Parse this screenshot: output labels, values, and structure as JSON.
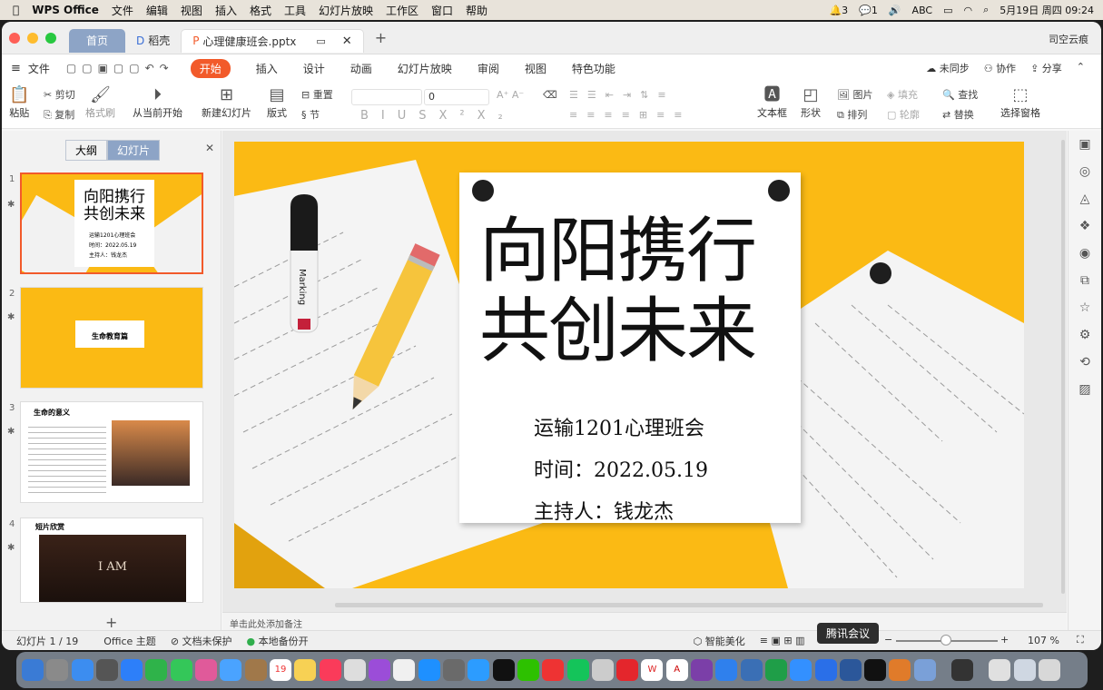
{
  "menubar": {
    "app": "WPS Office",
    "items": [
      "文件",
      "编辑",
      "视图",
      "插入",
      "格式",
      "工具",
      "幻灯片放映",
      "工作区",
      "窗口",
      "帮助"
    ],
    "status_count": "3",
    "wechat_count": "1",
    "input_method": "ABC",
    "datetime": "5月19日 周四  09:24"
  },
  "titlebar": {
    "tab_home": "首页",
    "tab_docer": "稻壳",
    "tab_file": "心理健康班会.pptx",
    "user": "司空云痕"
  },
  "ribbon_tabs": {
    "file": "文件",
    "start": "开始",
    "items": [
      "插入",
      "设计",
      "动画",
      "幻灯片放映",
      "审阅",
      "视图",
      "特色功能"
    ],
    "sync": "未同步",
    "collab": "协作",
    "share": "分享"
  },
  "ribbon": {
    "paste": "粘贴",
    "cut": "剪切",
    "copy": "复制",
    "format_painter": "格式刷",
    "from_current": "从当前开始",
    "new_slide": "新建幻灯片",
    "layout": "版式",
    "reset": "重置",
    "section": "节",
    "font_size": "0",
    "textbox": "文本框",
    "shape": "形状",
    "picture": "图片",
    "fill": "填充",
    "arrange": "排列",
    "outline": "轮廓",
    "find": "查找",
    "replace": "替换",
    "select_pane": "选择窗格"
  },
  "sidebar": {
    "outline": "大纲",
    "slides": "幻灯片",
    "thumbs": [
      {
        "num": "1",
        "title": "向阳携行\n共创未来",
        "l1": "运输1201心理班会",
        "l2": "时间：2022.05.19",
        "l3": "主持人：钱龙杰"
      },
      {
        "num": "2",
        "title": "生命教育篇"
      },
      {
        "num": "3",
        "title": "生命的意义"
      },
      {
        "num": "4",
        "title": "短片欣赏",
        "video": "I AM"
      }
    ]
  },
  "slide": {
    "title_line1": "向阳携行",
    "title_line2": "共创未来",
    "class": "运输1201心理班会",
    "time": "时间：2022.05.19",
    "host": "主持人：钱龙杰",
    "marker_text": "Marking"
  },
  "notes": "单击此处添加备注",
  "status": {
    "slide_info": "幻灯片 1 / 19",
    "theme": "Office 主题",
    "protect": "文档未保护",
    "backup": "本地备份开",
    "beautify": "智能美化",
    "zoom": "107 %"
  },
  "tooltip": "腾讯会议",
  "colors": {
    "accent": "#f25a2a",
    "slide_yellow": "#fbba14",
    "tab_blue": "#8da4c6"
  }
}
